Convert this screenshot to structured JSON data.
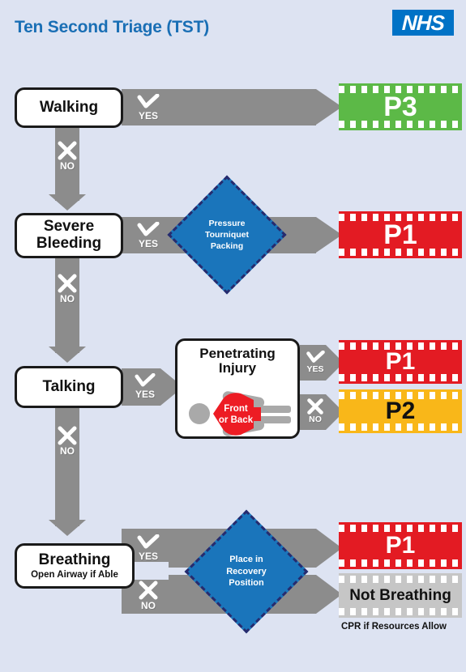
{
  "header": {
    "title": "Ten Second Triage (TST)",
    "logo_text": "NHS",
    "brand_blue": "#0072c6",
    "title_color": "#1a6fb5"
  },
  "labels": {
    "yes": "YES",
    "no": "NO"
  },
  "background_color": "#dde3f2",
  "connector_color": "#8c8c8c",
  "steps": [
    {
      "id": "walking",
      "title": "Walking",
      "subtitle": ""
    },
    {
      "id": "bleeding",
      "title": "Severe Bleeding",
      "subtitle": ""
    },
    {
      "id": "talking",
      "title": "Talking",
      "subtitle": ""
    },
    {
      "id": "breathing",
      "title": "Breathing",
      "subtitle": "Open Airway if Able"
    }
  ],
  "actions": [
    {
      "id": "bleeding-action",
      "text": "Pressure\nTourniquet\nPacking",
      "line1": "Pressure",
      "line2": "Tourniquet",
      "line3": "Packing",
      "fill": "#1a75bb",
      "border": "#262b6e"
    },
    {
      "id": "recovery-action",
      "text": "Place in\nRecovery\nPosition",
      "line1": "Place in",
      "line2": "Recovery",
      "line3": "Position",
      "fill": "#1a75bb",
      "border": "#262b6e"
    }
  ],
  "penetrating": {
    "title_line1": "Penetrating",
    "title_line2": "Injury",
    "body_line1": "Front",
    "body_line2": "or Back",
    "torso_color": "#ed1c24",
    "limb_color": "#a9a9a9"
  },
  "outcomes": [
    {
      "id": "walking-yes",
      "label": "P3",
      "bg": "#5cb947",
      "fg": "#ffffff",
      "size": 34
    },
    {
      "id": "bleeding-yes",
      "label": "P1",
      "bg": "#e31b23",
      "fg": "#ffffff",
      "size": 34
    },
    {
      "id": "penetrate-yes",
      "label": "P1",
      "bg": "#e31b23",
      "fg": "#ffffff",
      "size": 30
    },
    {
      "id": "penetrate-no",
      "label": "P2",
      "bg": "#f9b719",
      "fg": "#111111",
      "size": 30
    },
    {
      "id": "breathing-yes",
      "label": "P1",
      "bg": "#e31b23",
      "fg": "#ffffff",
      "size": 30
    },
    {
      "id": "breathing-no",
      "label": "Not Breathing",
      "bg": "#c6c6c6",
      "fg": "#111111",
      "size": 19
    }
  ],
  "footnote": "CPR if Resources Allow"
}
